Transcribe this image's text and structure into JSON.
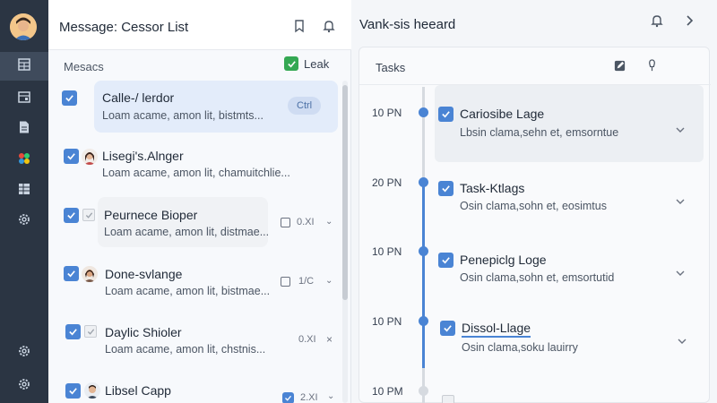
{
  "messages_panel": {
    "title": "Message: Cessor List",
    "section_label": "Mesacs",
    "filter_label": "Leak",
    "items": [
      {
        "name": "Calle-/ lerdor",
        "preview": "Loam acame, amon lit, bistmts...",
        "badge": "Ctrl",
        "selected": true
      },
      {
        "name": "Lisegi's.Alnger",
        "preview": "Loam acame, amon lit, chamuitchlie..."
      },
      {
        "name": "Peurnece Bioper",
        "preview": "Loam acame, amon lit, distmae...",
        "count": "0.XI"
      },
      {
        "name": "Done-svlange",
        "preview": "Loam acame, amon lit, bistmae...",
        "count": "1/C"
      },
      {
        "name": "Daylic Shioler",
        "preview": "Loam acame, amon lit, chstnis...",
        "count": "0.XI"
      },
      {
        "name": "Libsel Capp",
        "count": "2.XI"
      }
    ]
  },
  "tasks_panel": {
    "title": "Vank-sis heeard",
    "section_label": "Tasks",
    "items": [
      {
        "time": "10 PN",
        "title": "Cariosibe Lage",
        "desc": "Lbsin clama,sehn et, emsorntue"
      },
      {
        "time": "20 PN",
        "title": "Task-Ktlags",
        "desc": "Osin clama,sohn et, eosimtus"
      },
      {
        "time": "10 PN",
        "title": "Penepiclg Loge",
        "desc": "Osin clama,sohn et, emsortutid"
      },
      {
        "time": "10 PN",
        "title": "Dissol-Llage",
        "desc": "Osin clama,soku lauirry"
      },
      {
        "time": "10 PM"
      }
    ]
  },
  "colors": {
    "accent": "#4a84d4",
    "sidebar": "#2b3543",
    "selected_card": "#e3ecfa",
    "filter_checkbox": "#34a853"
  },
  "icons": {
    "rail": [
      "user-avatar",
      "grid-icon",
      "calendar-icon",
      "document-icon",
      "apps-icon",
      "table-icon",
      "settings-icon",
      "settings-icon",
      "settings-icon"
    ],
    "messages_header": [
      "bookmark-icon",
      "bell-icon"
    ],
    "tasks_header": [
      "bell-icon",
      "chevron-right-icon"
    ],
    "tasks_toolbar": [
      "edit-icon",
      "pin-icon"
    ]
  }
}
